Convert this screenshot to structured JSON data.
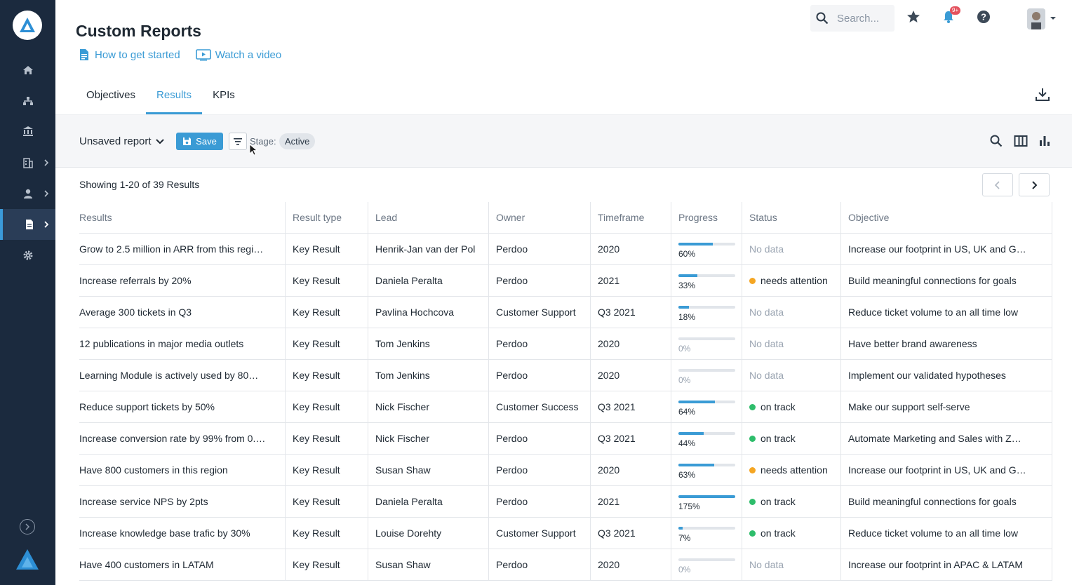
{
  "page": {
    "title": "Custom Reports"
  },
  "help": {
    "started": "How to get started",
    "video": "Watch a video"
  },
  "topbar": {
    "search_placeholder": "Search...",
    "notif_badge": "9+"
  },
  "tabs": [
    {
      "label": "Objectives"
    },
    {
      "label": "Results"
    },
    {
      "label": "KPIs"
    }
  ],
  "toolbar": {
    "report_name": "Unsaved report",
    "save": "Save",
    "stage_label": "Stage:",
    "stage_value": "Active"
  },
  "showing": "Showing 1-20 of 39 Results",
  "columns": [
    "Results",
    "Result type",
    "Lead",
    "Owner",
    "Timeframe",
    "Progress",
    "Status",
    "Objective"
  ],
  "rows": [
    {
      "result": "Grow to 2.5 million in ARR from this regi…",
      "type": "Key Result",
      "lead": "Henrik-Jan van der Pol",
      "owner": "Perdoo",
      "timeframe": "2020",
      "progress": 60,
      "progress_label": "60%",
      "status": "No data",
      "status_kind": "none",
      "objective": "Increase our footprint in US, UK and G…"
    },
    {
      "result": "Increase referrals by 20%",
      "type": "Key Result",
      "lead": "Daniela Peralta",
      "owner": "Perdoo",
      "timeframe": "2021",
      "progress": 33,
      "progress_label": "33%",
      "status": "needs attention",
      "status_kind": "warn",
      "objective": "Build meaningful connections for goals"
    },
    {
      "result": "Average 300 tickets in Q3",
      "type": "Key Result",
      "lead": "Pavlina Hochcova",
      "owner": "Customer Support",
      "timeframe": "Q3 2021",
      "progress": 18,
      "progress_label": "18%",
      "status": "No data",
      "status_kind": "none",
      "objective": "Reduce ticket volume to an all time low"
    },
    {
      "result": "12 publications in major media outlets",
      "type": "Key Result",
      "lead": "Tom Jenkins",
      "owner": "Perdoo",
      "timeframe": "2020",
      "progress": 0,
      "progress_label": "0%",
      "status": "No data",
      "status_kind": "none",
      "objective": "Have better brand awareness"
    },
    {
      "result": "Learning Module is actively used by 80…",
      "type": "Key Result",
      "lead": "Tom Jenkins",
      "owner": "Perdoo",
      "timeframe": "2020",
      "progress": 0,
      "progress_label": "0%",
      "status": "No data",
      "status_kind": "none",
      "objective": "Implement our validated hypotheses"
    },
    {
      "result": "Reduce support tickets by 50%",
      "type": "Key Result",
      "lead": "Nick Fischer",
      "owner": "Customer Success",
      "timeframe": "Q3 2021",
      "progress": 64,
      "progress_label": "64%",
      "status": "on track",
      "status_kind": "ok",
      "objective": "Make our support self-serve"
    },
    {
      "result": "Increase conversion rate by 99% from 0.…",
      "type": "Key Result",
      "lead": "Nick Fischer",
      "owner": "Perdoo",
      "timeframe": "Q3 2021",
      "progress": 44,
      "progress_label": "44%",
      "status": "on track",
      "status_kind": "ok",
      "objective": "Automate Marketing and Sales with Z…"
    },
    {
      "result": "Have 800 customers in this region",
      "type": "Key Result",
      "lead": "Susan Shaw",
      "owner": "Perdoo",
      "timeframe": "2020",
      "progress": 63,
      "progress_label": "63%",
      "status": "needs attention",
      "status_kind": "warn",
      "objective": "Increase our footprint in US, UK and G…"
    },
    {
      "result": "Increase service NPS by 2pts",
      "type": "Key Result",
      "lead": "Daniela Peralta",
      "owner": "Perdoo",
      "timeframe": "2021",
      "progress": 100,
      "progress_label": "175%",
      "status": "on track",
      "status_kind": "ok",
      "objective": "Build meaningful connections for goals"
    },
    {
      "result": "Increase knowledge base trafic by 30%",
      "type": "Key Result",
      "lead": "Louise Dorehty",
      "owner": "Customer Support",
      "timeframe": "Q3 2021",
      "progress": 7,
      "progress_label": "7%",
      "status": "on track",
      "status_kind": "ok",
      "objective": "Reduce ticket volume to an all time low"
    },
    {
      "result": "Have 400 customers in LATAM",
      "type": "Key Result",
      "lead": "Susan Shaw",
      "owner": "Perdoo",
      "timeframe": "2020",
      "progress": 0,
      "progress_label": "0%",
      "status": "No data",
      "status_kind": "none",
      "objective": "Increase our footprint in APAC & LATAM"
    }
  ],
  "colors": {
    "accent": "#3a9bd5",
    "sidebar": "#1b2a3e",
    "ok": "#2ebd6b",
    "warn": "#f5a623"
  }
}
